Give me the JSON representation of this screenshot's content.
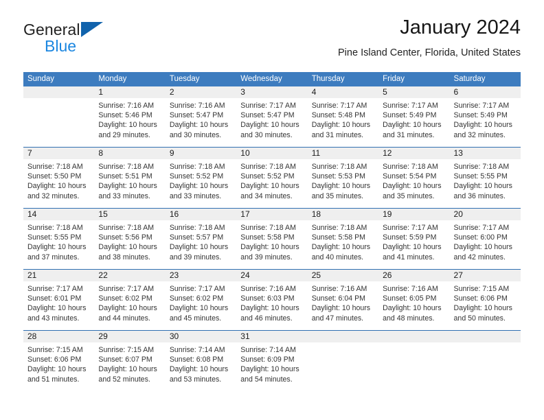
{
  "brand": {
    "name_top": "General",
    "name_bottom": "Blue",
    "triangle_color": "#1163ac",
    "blue_color": "#1b86e0"
  },
  "header": {
    "title": "January 2024",
    "subtitle": "Pine Island Center, Florida, United States"
  },
  "theme": {
    "header_band": "#3d7cbf",
    "week_divider": "#2f6fb1",
    "day_number_band": "#efefef"
  },
  "calendar": {
    "weekdays": [
      "Sunday",
      "Monday",
      "Tuesday",
      "Wednesday",
      "Thursday",
      "Friday",
      "Saturday"
    ],
    "weeks": [
      [
        {
          "day": "",
          "lines": []
        },
        {
          "day": "1",
          "lines": [
            "Sunrise: 7:16 AM",
            "Sunset: 5:46 PM",
            "Daylight: 10 hours",
            "and 29 minutes."
          ]
        },
        {
          "day": "2",
          "lines": [
            "Sunrise: 7:16 AM",
            "Sunset: 5:47 PM",
            "Daylight: 10 hours",
            "and 30 minutes."
          ]
        },
        {
          "day": "3",
          "lines": [
            "Sunrise: 7:17 AM",
            "Sunset: 5:47 PM",
            "Daylight: 10 hours",
            "and 30 minutes."
          ]
        },
        {
          "day": "4",
          "lines": [
            "Sunrise: 7:17 AM",
            "Sunset: 5:48 PM",
            "Daylight: 10 hours",
            "and 31 minutes."
          ]
        },
        {
          "day": "5",
          "lines": [
            "Sunrise: 7:17 AM",
            "Sunset: 5:49 PM",
            "Daylight: 10 hours",
            "and 31 minutes."
          ]
        },
        {
          "day": "6",
          "lines": [
            "Sunrise: 7:17 AM",
            "Sunset: 5:49 PM",
            "Daylight: 10 hours",
            "and 32 minutes."
          ]
        }
      ],
      [
        {
          "day": "7",
          "lines": [
            "Sunrise: 7:18 AM",
            "Sunset: 5:50 PM",
            "Daylight: 10 hours",
            "and 32 minutes."
          ]
        },
        {
          "day": "8",
          "lines": [
            "Sunrise: 7:18 AM",
            "Sunset: 5:51 PM",
            "Daylight: 10 hours",
            "and 33 minutes."
          ]
        },
        {
          "day": "9",
          "lines": [
            "Sunrise: 7:18 AM",
            "Sunset: 5:52 PM",
            "Daylight: 10 hours",
            "and 33 minutes."
          ]
        },
        {
          "day": "10",
          "lines": [
            "Sunrise: 7:18 AM",
            "Sunset: 5:52 PM",
            "Daylight: 10 hours",
            "and 34 minutes."
          ]
        },
        {
          "day": "11",
          "lines": [
            "Sunrise: 7:18 AM",
            "Sunset: 5:53 PM",
            "Daylight: 10 hours",
            "and 35 minutes."
          ]
        },
        {
          "day": "12",
          "lines": [
            "Sunrise: 7:18 AM",
            "Sunset: 5:54 PM",
            "Daylight: 10 hours",
            "and 35 minutes."
          ]
        },
        {
          "day": "13",
          "lines": [
            "Sunrise: 7:18 AM",
            "Sunset: 5:55 PM",
            "Daylight: 10 hours",
            "and 36 minutes."
          ]
        }
      ],
      [
        {
          "day": "14",
          "lines": [
            "Sunrise: 7:18 AM",
            "Sunset: 5:55 PM",
            "Daylight: 10 hours",
            "and 37 minutes."
          ]
        },
        {
          "day": "15",
          "lines": [
            "Sunrise: 7:18 AM",
            "Sunset: 5:56 PM",
            "Daylight: 10 hours",
            "and 38 minutes."
          ]
        },
        {
          "day": "16",
          "lines": [
            "Sunrise: 7:18 AM",
            "Sunset: 5:57 PM",
            "Daylight: 10 hours",
            "and 39 minutes."
          ]
        },
        {
          "day": "17",
          "lines": [
            "Sunrise: 7:18 AM",
            "Sunset: 5:58 PM",
            "Daylight: 10 hours",
            "and 39 minutes."
          ]
        },
        {
          "day": "18",
          "lines": [
            "Sunrise: 7:18 AM",
            "Sunset: 5:58 PM",
            "Daylight: 10 hours",
            "and 40 minutes."
          ]
        },
        {
          "day": "19",
          "lines": [
            "Sunrise: 7:17 AM",
            "Sunset: 5:59 PM",
            "Daylight: 10 hours",
            "and 41 minutes."
          ]
        },
        {
          "day": "20",
          "lines": [
            "Sunrise: 7:17 AM",
            "Sunset: 6:00 PM",
            "Daylight: 10 hours",
            "and 42 minutes."
          ]
        }
      ],
      [
        {
          "day": "21",
          "lines": [
            "Sunrise: 7:17 AM",
            "Sunset: 6:01 PM",
            "Daylight: 10 hours",
            "and 43 minutes."
          ]
        },
        {
          "day": "22",
          "lines": [
            "Sunrise: 7:17 AM",
            "Sunset: 6:02 PM",
            "Daylight: 10 hours",
            "and 44 minutes."
          ]
        },
        {
          "day": "23",
          "lines": [
            "Sunrise: 7:17 AM",
            "Sunset: 6:02 PM",
            "Daylight: 10 hours",
            "and 45 minutes."
          ]
        },
        {
          "day": "24",
          "lines": [
            "Sunrise: 7:16 AM",
            "Sunset: 6:03 PM",
            "Daylight: 10 hours",
            "and 46 minutes."
          ]
        },
        {
          "day": "25",
          "lines": [
            "Sunrise: 7:16 AM",
            "Sunset: 6:04 PM",
            "Daylight: 10 hours",
            "and 47 minutes."
          ]
        },
        {
          "day": "26",
          "lines": [
            "Sunrise: 7:16 AM",
            "Sunset: 6:05 PM",
            "Daylight: 10 hours",
            "and 48 minutes."
          ]
        },
        {
          "day": "27",
          "lines": [
            "Sunrise: 7:15 AM",
            "Sunset: 6:06 PM",
            "Daylight: 10 hours",
            "and 50 minutes."
          ]
        }
      ],
      [
        {
          "day": "28",
          "lines": [
            "Sunrise: 7:15 AM",
            "Sunset: 6:06 PM",
            "Daylight: 10 hours",
            "and 51 minutes."
          ]
        },
        {
          "day": "29",
          "lines": [
            "Sunrise: 7:15 AM",
            "Sunset: 6:07 PM",
            "Daylight: 10 hours",
            "and 52 minutes."
          ]
        },
        {
          "day": "30",
          "lines": [
            "Sunrise: 7:14 AM",
            "Sunset: 6:08 PM",
            "Daylight: 10 hours",
            "and 53 minutes."
          ]
        },
        {
          "day": "31",
          "lines": [
            "Sunrise: 7:14 AM",
            "Sunset: 6:09 PM",
            "Daylight: 10 hours",
            "and 54 minutes."
          ]
        },
        {
          "day": "",
          "lines": []
        },
        {
          "day": "",
          "lines": []
        },
        {
          "day": "",
          "lines": []
        }
      ]
    ]
  }
}
